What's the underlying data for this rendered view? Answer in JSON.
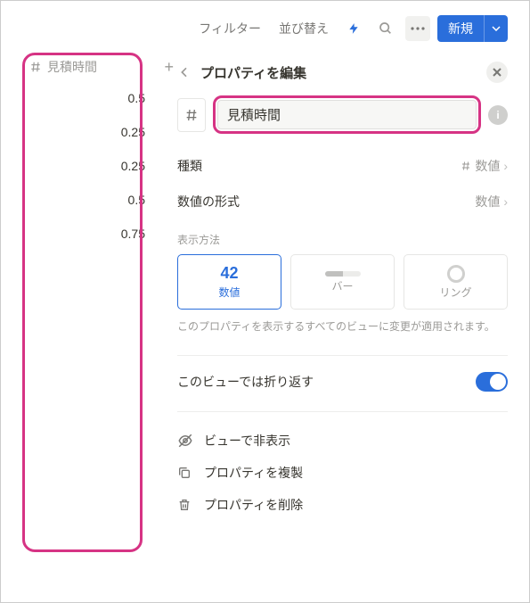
{
  "topbar": {
    "filter_label": "フィルター",
    "sort_label": "並び替え",
    "new_label": "新規"
  },
  "column": {
    "header": "見積時間",
    "values": [
      "0.5",
      "0.25",
      "0.25",
      "0.5",
      "0.75"
    ]
  },
  "panel": {
    "title": "プロパティを編集",
    "name_value": "見積時間",
    "type_label": "種類",
    "type_value": "数値",
    "format_label": "数値の形式",
    "format_value": "数値",
    "display_label": "表示方法",
    "display_options": {
      "number": {
        "visual": "42",
        "label": "数値"
      },
      "bar": {
        "label": "バー"
      },
      "ring": {
        "label": "リング"
      }
    },
    "note": "このプロパティを表示するすべてのビューに変更が適用されます。",
    "wrap_label": "このビューでは折り返す",
    "actions": {
      "hide": "ビューで非表示",
      "duplicate": "プロパティを複製",
      "delete": "プロパティを削除"
    }
  }
}
